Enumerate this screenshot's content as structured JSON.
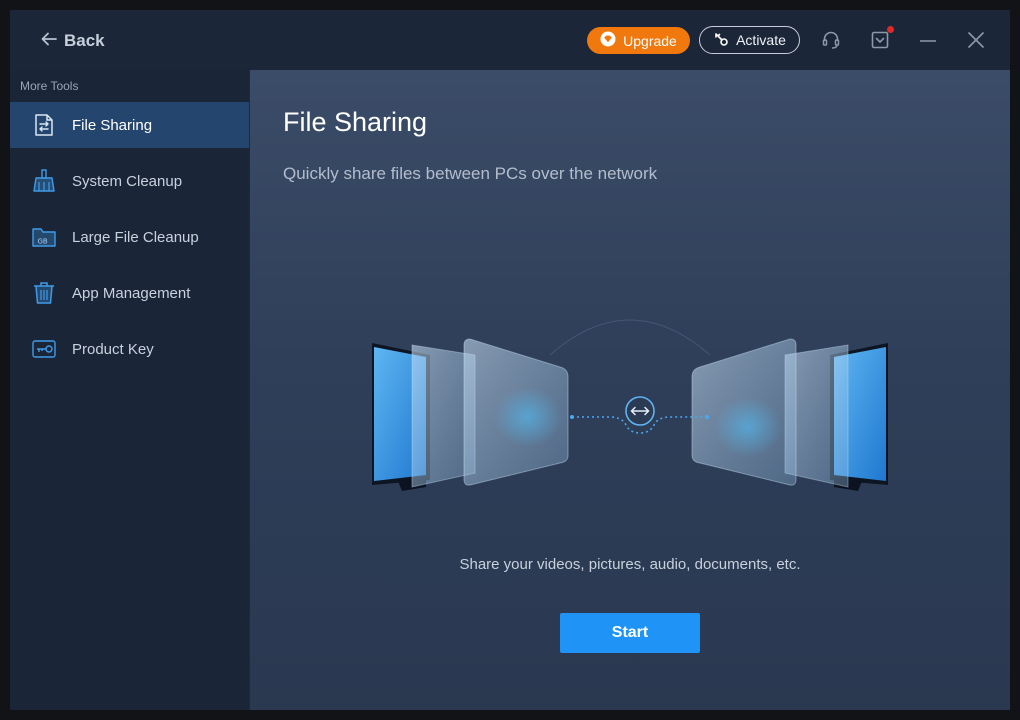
{
  "titlebar": {
    "back_label": "Back",
    "upgrade_label": "Upgrade",
    "activate_label": "Activate",
    "icons": [
      "support-headset-icon",
      "notification-icon",
      "minimize-icon",
      "close-icon"
    ]
  },
  "sidebar": {
    "title": "More Tools",
    "items": [
      {
        "label": "File Sharing",
        "icon": "file-sharing-icon",
        "active": true
      },
      {
        "label": "System Cleanup",
        "icon": "broom-icon",
        "active": false
      },
      {
        "label": "Large File Cleanup",
        "icon": "folder-gb-icon",
        "active": false
      },
      {
        "label": "App Management",
        "icon": "trash-icon",
        "active": false
      },
      {
        "label": "Product Key",
        "icon": "key-icon",
        "active": false
      }
    ]
  },
  "main": {
    "title": "File Sharing",
    "subtitle": "Quickly share files between PCs over the network",
    "description": "Share your videos, pictures, audio, documents, etc.",
    "start_label": "Start"
  },
  "colors": {
    "accent": "#1f93f6",
    "upgrade": "#f0780d",
    "sidebar_active": "#23456e",
    "notification_dot": "#e02a2a"
  }
}
